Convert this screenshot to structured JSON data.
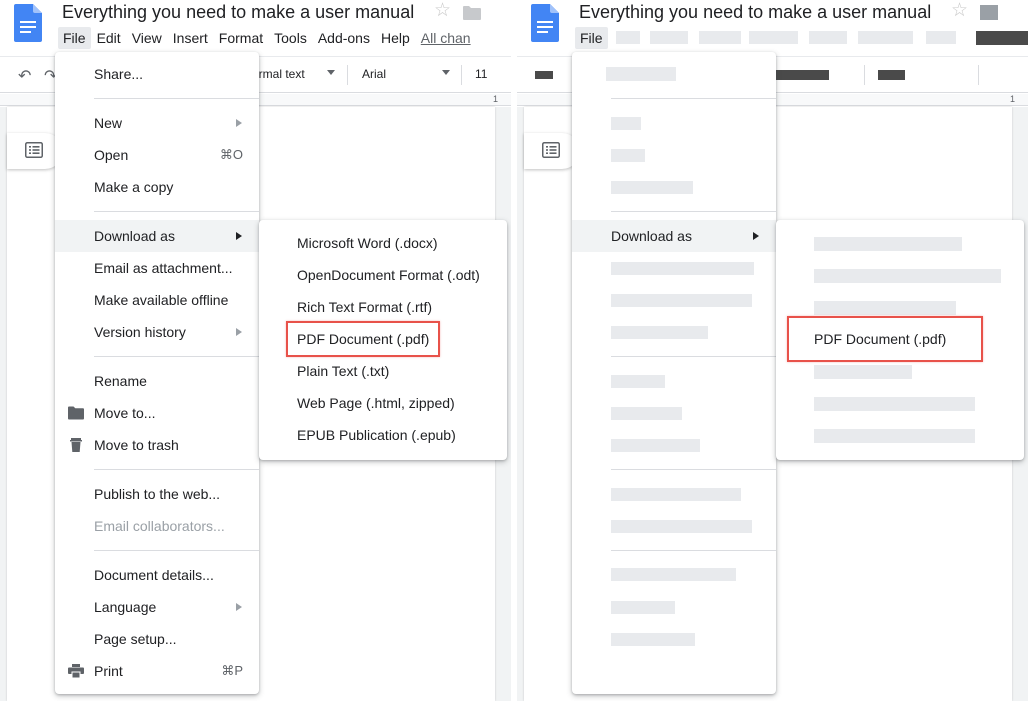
{
  "doc": {
    "title": "Everything you need to make a user manual"
  },
  "menubar": {
    "items": [
      "File",
      "Edit",
      "View",
      "Insert",
      "Format",
      "Tools",
      "Add-ons",
      "Help"
    ],
    "last_edit": "All chan"
  },
  "toolbar": {
    "style": "ormal text",
    "font": "Arial",
    "size": "11"
  },
  "ruler": {
    "marker": "1"
  },
  "file_menu": {
    "items": [
      {
        "label": "Share...",
        "shortcut": "",
        "submenu": false,
        "disabled": false
      },
      {
        "label": "New",
        "shortcut": "",
        "submenu": true,
        "disabled": false
      },
      {
        "label": "Open",
        "shortcut": "⌘O",
        "submenu": false,
        "disabled": false
      },
      {
        "label": "Make a copy",
        "shortcut": "",
        "submenu": false,
        "disabled": false
      },
      {
        "label": "Download as",
        "shortcut": "",
        "submenu": true,
        "disabled": false
      },
      {
        "label": "Email as attachment...",
        "shortcut": "",
        "submenu": false,
        "disabled": false
      },
      {
        "label": "Make available offline",
        "shortcut": "",
        "submenu": false,
        "disabled": false
      },
      {
        "label": "Version history",
        "shortcut": "",
        "submenu": true,
        "disabled": false
      },
      {
        "label": "Rename",
        "shortcut": "",
        "submenu": false,
        "disabled": false
      },
      {
        "label": "Move to...",
        "shortcut": "",
        "submenu": false,
        "disabled": false
      },
      {
        "label": "Move to trash",
        "shortcut": "",
        "submenu": false,
        "disabled": false
      },
      {
        "label": "Publish to the web...",
        "shortcut": "",
        "submenu": false,
        "disabled": false
      },
      {
        "label": "Email collaborators...",
        "shortcut": "",
        "submenu": false,
        "disabled": true
      },
      {
        "label": "Document details...",
        "shortcut": "",
        "submenu": false,
        "disabled": false
      },
      {
        "label": "Language",
        "shortcut": "",
        "submenu": true,
        "disabled": false
      },
      {
        "label": "Page setup...",
        "shortcut": "",
        "submenu": false,
        "disabled": false
      },
      {
        "label": "Print",
        "shortcut": "⌘P",
        "submenu": false,
        "disabled": false
      }
    ]
  },
  "download_menu": {
    "items": [
      "Microsoft Word (.docx)",
      "OpenDocument Format (.odt)",
      "Rich Text Format (.rtf)",
      "PDF Document (.pdf)",
      "Plain Text (.txt)",
      "Web Page (.html, zipped)",
      "EPUB Publication (.epub)"
    ],
    "highlighted": "PDF Document (.pdf)"
  },
  "colors": {
    "highlight_box": "#e8524a",
    "doc_icon": "#4285f4",
    "active_menu_bg": "#e8eaed"
  },
  "icons": {
    "doc": "docs-icon",
    "star": "star-icon",
    "folder": "folder-icon",
    "undo": "undo-icon",
    "redo": "redo-icon",
    "outline": "outline-icon",
    "move": "folder-icon",
    "trash": "trash-icon",
    "print": "print-icon"
  }
}
